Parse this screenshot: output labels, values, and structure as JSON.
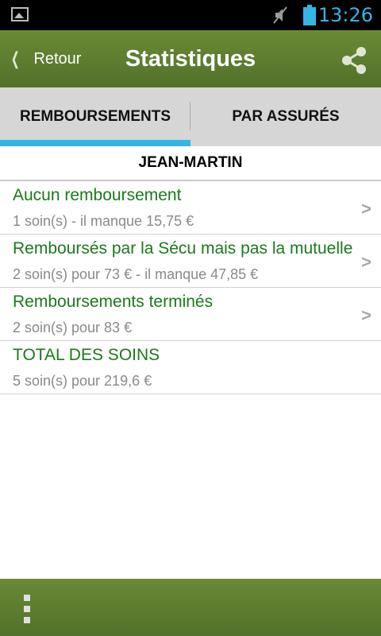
{
  "status_bar": {
    "time": "13:26",
    "icons": [
      "image-notification-icon",
      "mute-icon",
      "battery-icon"
    ]
  },
  "action_bar": {
    "back_label": "Retour",
    "title": "Statistiques",
    "share_icon": "share-icon"
  },
  "tabs": [
    {
      "label": "REMBOURSEMENTS",
      "active": true
    },
    {
      "label": "PAR ASSURÉS",
      "active": false
    }
  ],
  "section": {
    "header": "JEAN-MARTIN"
  },
  "list": [
    {
      "title": "Aucun remboursement",
      "subtitle": "1 soin(s) - il manque 15,75 €",
      "has_arrow": true
    },
    {
      "title": "Remboursés par la Sécu mais pas la mutuelle",
      "subtitle": "2 soin(s) pour 73 € - il manque 47,85 €",
      "has_arrow": true
    },
    {
      "title": "Remboursements terminés",
      "subtitle": "2 soin(s) pour 83 €",
      "has_arrow": true
    },
    {
      "title": "TOTAL DES SOINS",
      "subtitle": "5 soin(s) pour 219,6 €",
      "has_arrow": false
    }
  ],
  "colors": {
    "action_bar": "#5e7e30",
    "tab_indicator": "#33b5e5",
    "item_title": "#1a7a1a",
    "item_subtitle": "#8a8a8a"
  }
}
